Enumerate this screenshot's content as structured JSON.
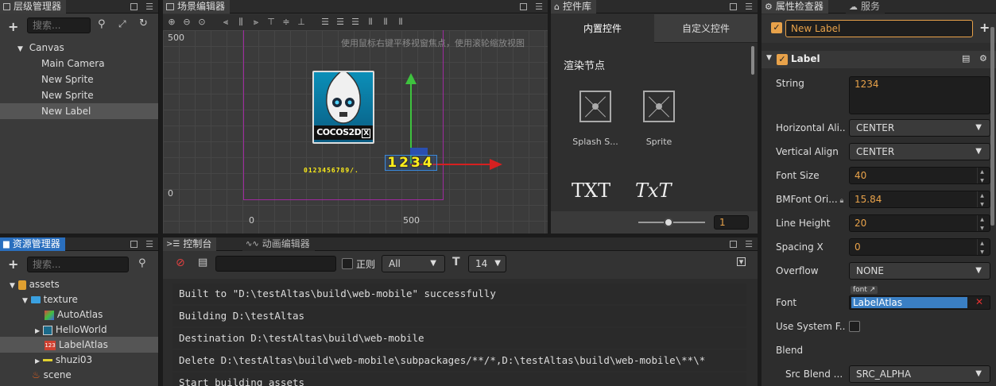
{
  "hierarchy": {
    "title": "层级管理器",
    "search_placeholder": "搜索...",
    "items": [
      "Canvas",
      "Main Camera",
      "New Sprite",
      "New Sprite",
      "New Label"
    ]
  },
  "scene": {
    "title": "场景编辑器",
    "hint": "使用鼠标右键平移视窗焦点，使用滚轮缩放视图",
    "y500": "500",
    "y0": "0",
    "x0": "0",
    "x500": "500",
    "label_text": "1234",
    "atlas_text": "0123456789/.",
    "logo_text": "COCOS2D"
  },
  "library": {
    "title": "控件库",
    "tab_builtin": "内置控件",
    "tab_custom": "自定义控件",
    "section": "渲染节点",
    "items": [
      "Splash S...",
      "Sprite"
    ],
    "txt1": "TXT",
    "txt2": "TxT",
    "zoom": "1"
  },
  "inspector": {
    "title": "属性检查器",
    "tab_service": "服务",
    "node_name": "New Label",
    "component": "Label",
    "props": {
      "string_label": "String",
      "string_value": "1234",
      "halign_label": "Horizontal Ali...",
      "halign_value": "CENTER",
      "valign_label": "Vertical Align",
      "valign_value": "CENTER",
      "fontsize_label": "Font Size",
      "fontsize_value": "40",
      "bmfont_label": "BMFont Ori...",
      "bmfont_value": "15.84",
      "lineheight_label": "Line Height",
      "lineheight_value": "20",
      "spacingx_label": "Spacing X",
      "spacingx_value": "0",
      "overflow_label": "Overflow",
      "overflow_value": "NONE",
      "font_label": "Font",
      "font_tag": "font",
      "font_value": "LabelAtlas",
      "sysfont_label": "Use System F...",
      "blend_label": "Blend",
      "srcblend_label": "Src Blend ...",
      "srcblend_value": "SRC_ALPHA"
    }
  },
  "assets": {
    "title": "资源管理器",
    "search_placeholder": "搜索...",
    "items": [
      "assets",
      "texture",
      "AutoAtlas",
      "HelloWorld",
      "LabelAtlas",
      "shuzi03",
      "scene"
    ]
  },
  "console": {
    "tab_console": "控制台",
    "tab_anim": "动画编辑器",
    "regex_label": "正则",
    "level": "All",
    "fontsize": "14",
    "logs": [
      "Built to \"D:\\testAltas\\build\\web-mobile\" successfully",
      "Building D:\\testAltas",
      "Destination D:\\testAltas\\build\\web-mobile",
      "Delete D:\\testAltas\\build\\web-mobile\\subpackages/**/*,D:\\testAltas\\build\\web-mobile\\**\\*",
      "Start building assets"
    ]
  },
  "colors": {
    "accent": "#e8a24a",
    "blue_tab": "#2a6fbe",
    "selection": "#555555"
  }
}
